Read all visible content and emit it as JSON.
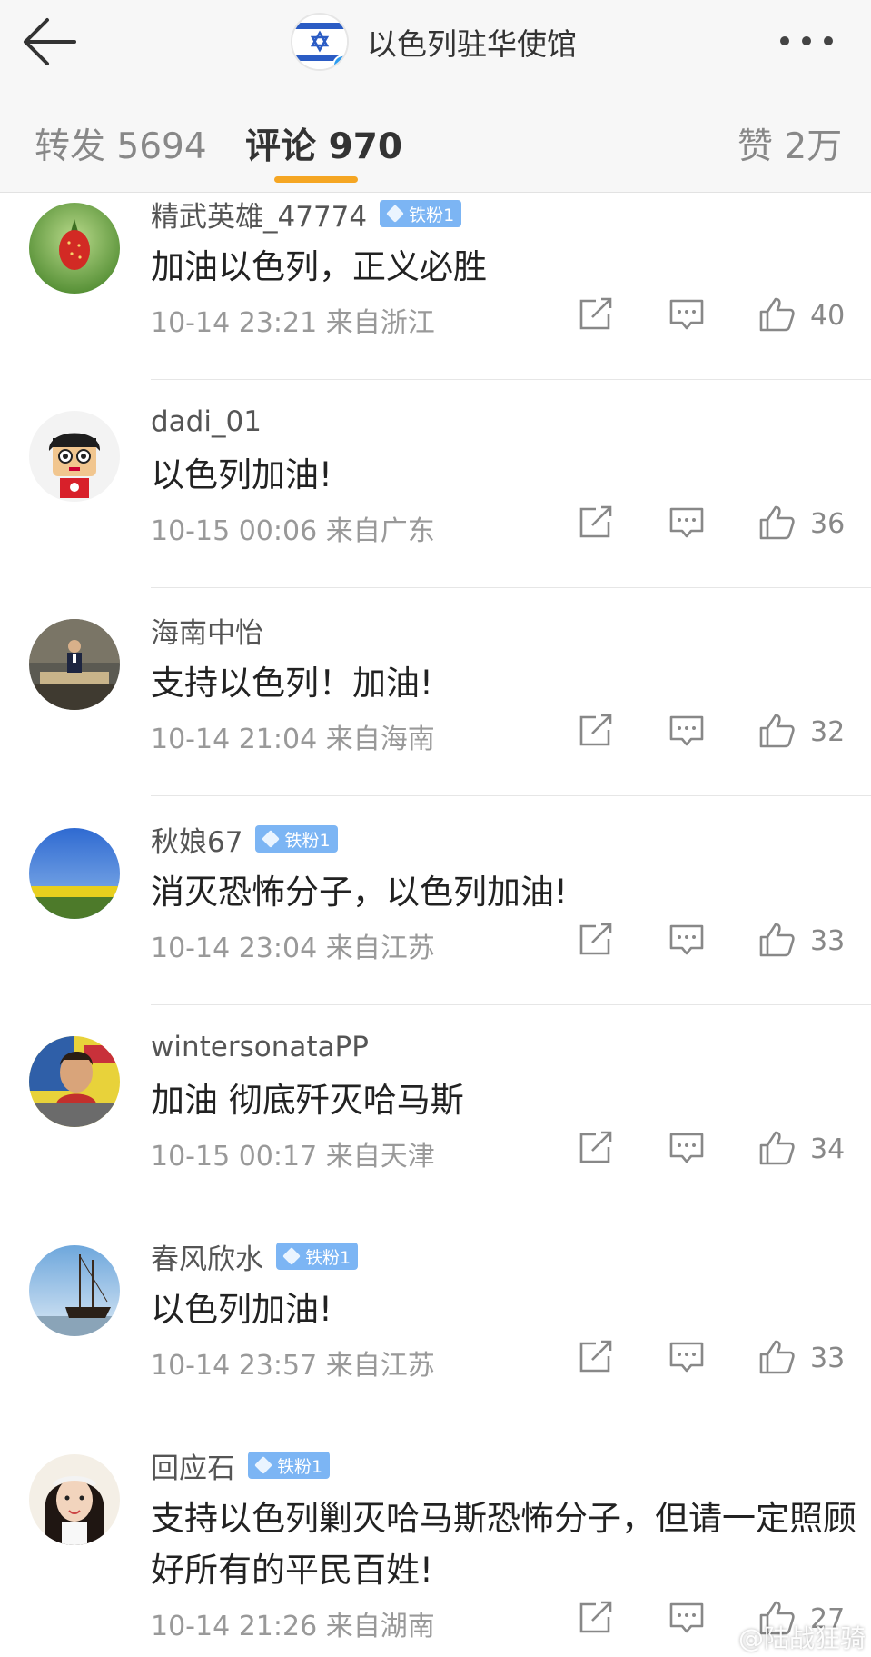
{
  "header": {
    "title": "以色列驻华使馆",
    "back_icon": "back-arrow-icon",
    "more_icon": "more-dots-icon"
  },
  "tabs": [
    {
      "label": "转发 5694"
    },
    {
      "label": "评论 970"
    },
    {
      "label": "赞 2万"
    }
  ],
  "comments": [
    {
      "username": "精武英雄_47774",
      "badge": "铁粉1",
      "content": "加油以色列，正义必胜",
      "time": "10-14 23:21",
      "location": "来自浙江",
      "likes": "40"
    },
    {
      "username": "dadi_01",
      "badge": "",
      "content": "以色列加油!",
      "time": "10-15 00:06",
      "location": "来自广东",
      "likes": "36"
    },
    {
      "username": "海南中怡",
      "badge": "",
      "content": "支持以色列！加油!",
      "time": "10-14 21:04",
      "location": "来自海南",
      "likes": "32"
    },
    {
      "username": "秋娘67",
      "badge": "铁粉1",
      "content": "消灭恐怖分子，以色列加油!",
      "time": "10-14 23:04",
      "location": "来自江苏",
      "likes": "33"
    },
    {
      "username": "wintersonataPP",
      "badge": "",
      "content": "加油 彻底歼灭哈马斯",
      "time": "10-15 00:17",
      "location": "来自天津",
      "likes": "34"
    },
    {
      "username": "春风欣水",
      "badge": "铁粉1",
      "content": "以色列加油!",
      "time": "10-14 23:57",
      "location": "来自江苏",
      "likes": "33"
    },
    {
      "username": "回应石",
      "badge": "铁粉1",
      "content": "支持以色列剿灭哈马斯恐怖分子，但请一定照顾好所有的平民百姓!",
      "time": "10-14 21:26",
      "location": "来自湖南",
      "likes": "27"
    }
  ],
  "watermark": "@陆战狂骑",
  "colors": {
    "accent": "#f5a623",
    "badge": "#7cb5f4",
    "verified": "#2c9cf0"
  }
}
